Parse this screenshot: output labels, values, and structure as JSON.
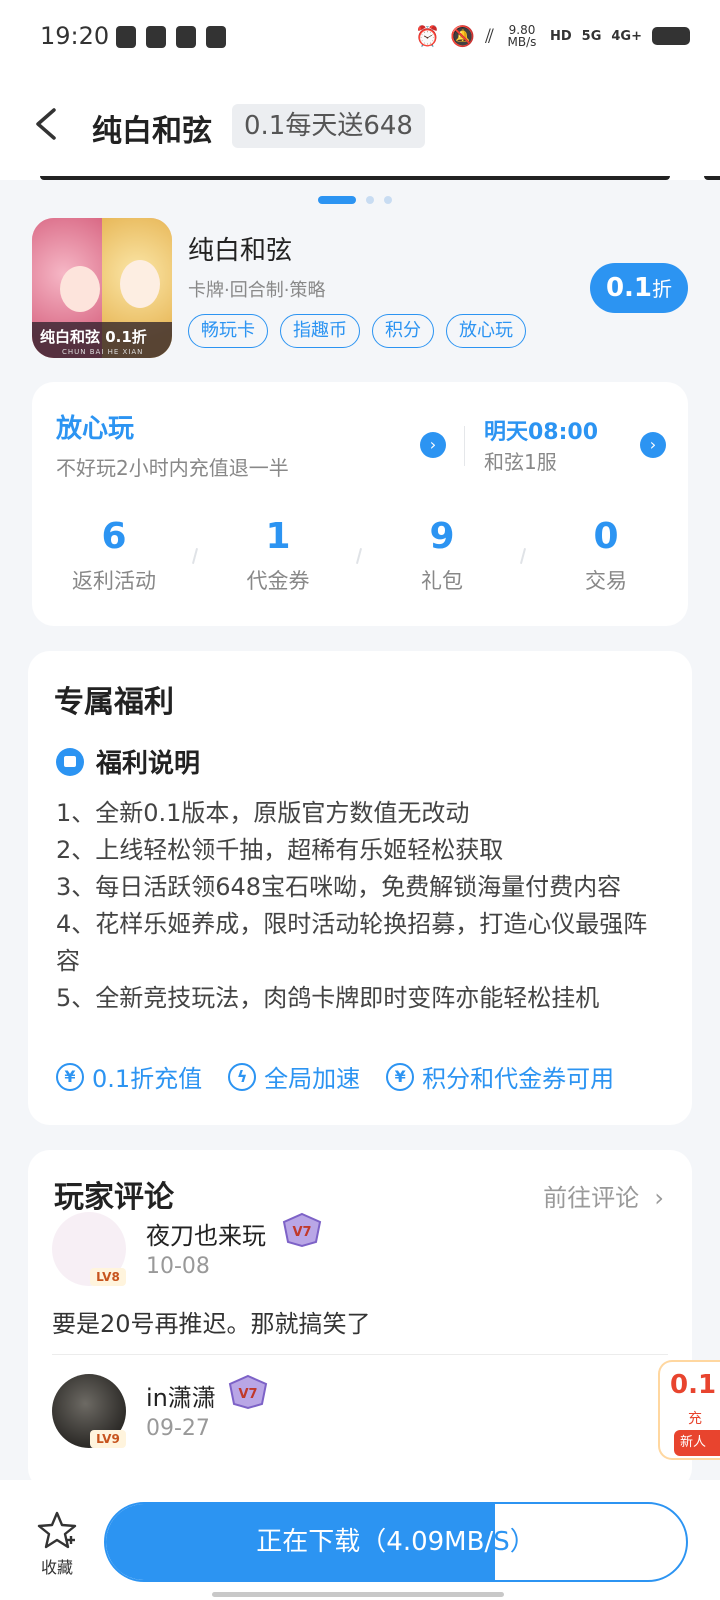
{
  "status_bar": {
    "time": "19:20",
    "net_speed": "9.80\nMB/s",
    "tags": [
      "HD",
      "5G",
      "4G+"
    ]
  },
  "nav": {
    "title": "纯白和弦",
    "badge": "0.1每天送648"
  },
  "game": {
    "name": "纯白和弦",
    "icon_caption": "纯白和弦 0.1折",
    "icon_sub": "CHUN BAI HE XIAN",
    "tags_line": "卡牌·回合制·策略",
    "chips": [
      "畅玩卡",
      "指趣币",
      "积分",
      "放心玩"
    ],
    "discount_num": "0.1",
    "discount_unit": "折"
  },
  "assurance": {
    "title": "放心玩",
    "desc": "不好玩2小时内充值退一半",
    "server_time": "明天08:00",
    "server_name": "和弦1服"
  },
  "stats": [
    {
      "num": "6",
      "label": "返利活动"
    },
    {
      "num": "1",
      "label": "代金券"
    },
    {
      "num": "9",
      "label": "礼包"
    },
    {
      "num": "0",
      "label": "交易"
    }
  ],
  "benefits": {
    "title": "专属福利",
    "subtitle": "福利说明",
    "lines": [
      "1、全新0.1版本，原版官方数值无改动",
      "2、上线轻松领千抽，超稀有乐姬轻松获取",
      "3、每日活跃领648宝石咪呦，免费解锁海量付费内容",
      "4、花样乐姬养成，限时活动轮换招募，打造心仪最强阵容",
      "5、全新竞技玩法，肉鸽卡牌即时变阵亦能轻松挂机"
    ],
    "features": [
      "0.1折充值",
      "全局加速",
      "积分和代金券可用"
    ]
  },
  "comments": {
    "title": "玩家评论",
    "link": "前往评论",
    "items": [
      {
        "name": "夜刀也来玩",
        "level": "LV8",
        "vip": "V7",
        "date": "10-08",
        "text": "要是20号再推迟。那就搞笑了"
      },
      {
        "name": "in潇潇",
        "level": "LV9",
        "vip": "V7",
        "date": "09-27",
        "text": ""
      }
    ]
  },
  "promo": {
    "num": "0.1",
    "sub": "充",
    "tag": "新人"
  },
  "bottom": {
    "fav_label": "收藏",
    "download_text": "正在下载（4.09MB/S）",
    "progress": 0.67
  },
  "colors": {
    "accent": "#2c94f2",
    "promo": "#e8442e"
  }
}
